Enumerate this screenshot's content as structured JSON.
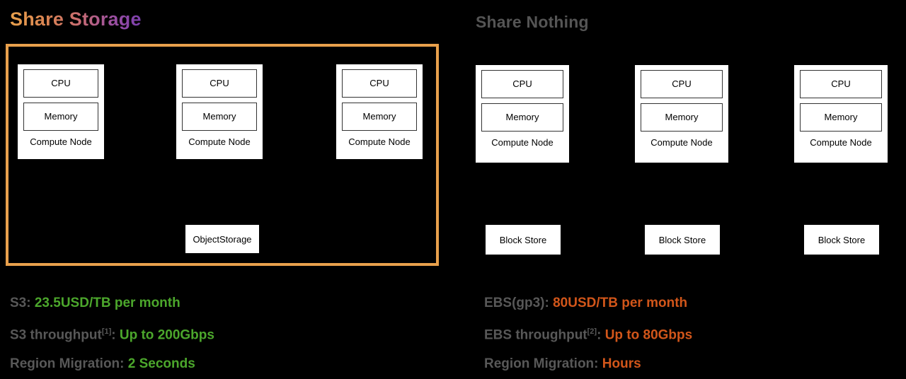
{
  "titles": {
    "left": "Share Storage",
    "right": "Share Nothing"
  },
  "colors": {
    "frame_orange": "#E8A04C",
    "value_green": "#4CA72C",
    "value_orange": "#D2561A",
    "label_gray": "#585858",
    "background": "#000000"
  },
  "left_architecture": {
    "nodes": [
      {
        "cpu": "CPU",
        "memory": "Memory",
        "label": "Compute Node"
      },
      {
        "cpu": "CPU",
        "memory": "Memory",
        "label": "Compute Node"
      },
      {
        "cpu": "CPU",
        "memory": "Memory",
        "label": "Compute Node"
      }
    ],
    "storage": {
      "label": "ObjectStorage"
    }
  },
  "right_architecture": {
    "nodes": [
      {
        "cpu": "CPU",
        "memory": "Memory",
        "label": "Compute Node"
      },
      {
        "cpu": "CPU",
        "memory": "Memory",
        "label": "Compute Node"
      },
      {
        "cpu": "CPU",
        "memory": "Memory",
        "label": "Compute Node"
      }
    ],
    "stores": [
      {
        "label": "Block Store"
      },
      {
        "label": "Block Store"
      },
      {
        "label": "Block Store"
      }
    ]
  },
  "left_facts": [
    {
      "label": "S3: ",
      "sup": "",
      "value": "23.5USD/TB per month"
    },
    {
      "label": "S3 throughput",
      "sup": "[1]",
      "value": "Up to 200Gbps",
      "sep": ": "
    },
    {
      "label": "Region Migration",
      "sup": "",
      "value": "2 Seconds",
      "sep": ": "
    }
  ],
  "right_facts": [
    {
      "label": "EBS(gp3): ",
      "sup": "",
      "value": "80USD/TB per month"
    },
    {
      "label": "EBS throughput",
      "sup": "[2]",
      "value": "Up to 80Gbps",
      "sep": ": "
    },
    {
      "label": "Region Migration",
      "sup": "",
      "value": "Hours",
      "sep": ": "
    }
  ]
}
